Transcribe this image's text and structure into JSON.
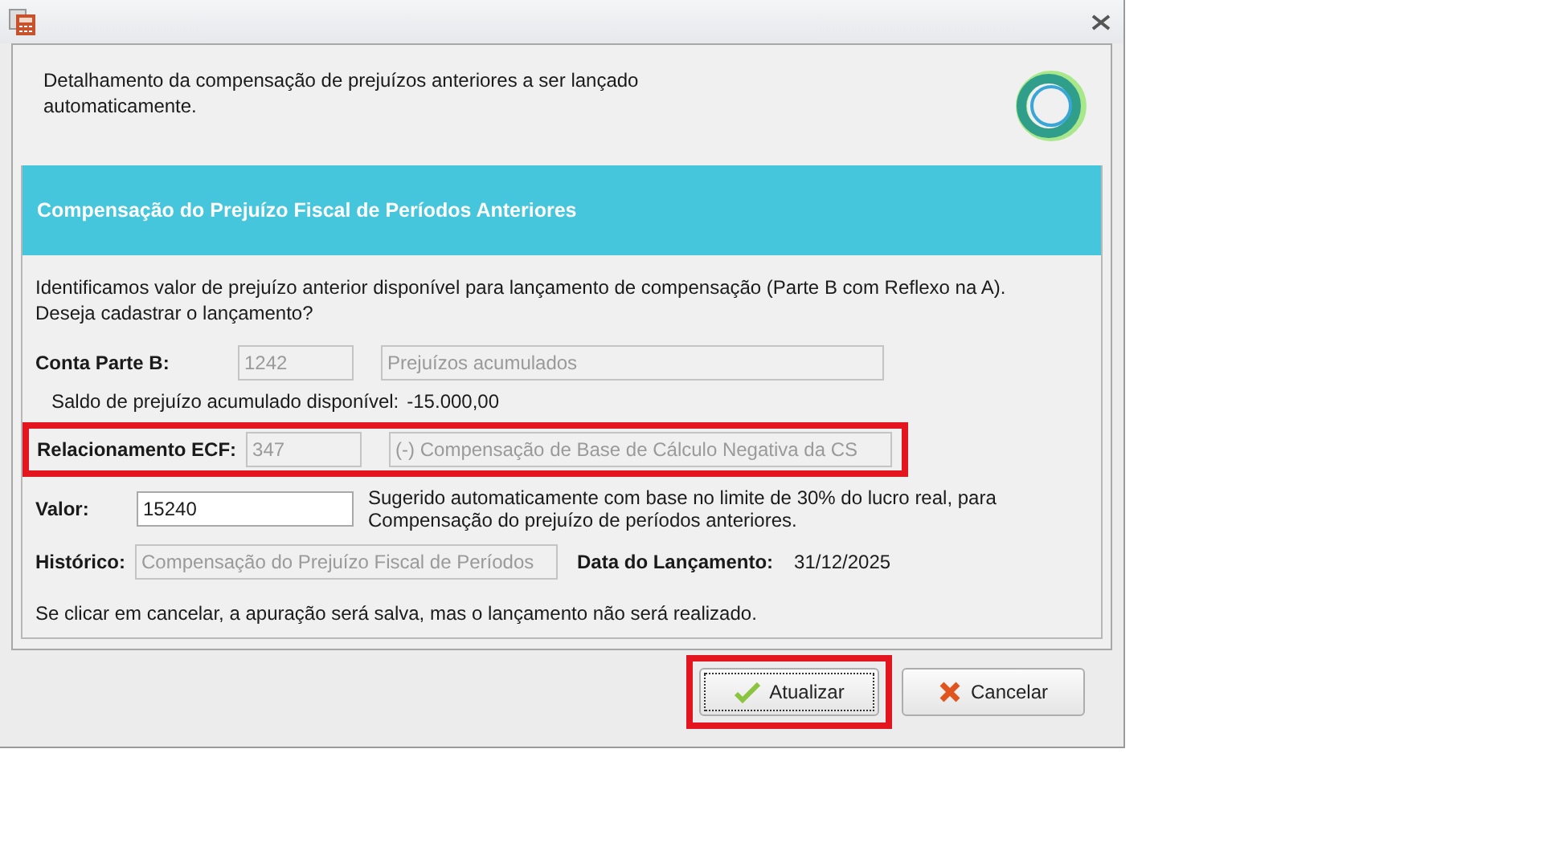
{
  "header": {
    "lines": [
      "Detalhamento da compensação de prejuízos anteriores a ser lançado",
      "automaticamente."
    ]
  },
  "section": {
    "title": "Compensação do Prejuízo Fiscal de Períodos Anteriores"
  },
  "intro": {
    "lines": [
      "Identificamos valor de prejuízo anterior disponível para lançamento de compensação (Parte B com Reflexo na A).",
      "Deseja cadastrar o lançamento?"
    ]
  },
  "conta_parte_b": {
    "label": "Conta Parte B:",
    "code": "1242",
    "name": "Prejuízos acumulados",
    "disabled": true
  },
  "saldo": {
    "label": "Saldo de prejuízo acumulado disponível:",
    "value": "-15.000,00"
  },
  "relacionamento": {
    "label": "Relacionamento ECF:",
    "code": "347",
    "name": "(-) Compensação de Base de Cálculo Negativa da CS",
    "disabled": true,
    "highlighted": true
  },
  "valor": {
    "label": "Valor:",
    "value": "15240",
    "disabled": false,
    "hint_lines": [
      "Sugerido automaticamente com base no limite de 30% do lucro real, para",
      "Compensação do prejuízo de períodos anteriores."
    ]
  },
  "historico": {
    "label": "Histórico:",
    "value": "Compensação do Prejuízo Fiscal de Períodos",
    "disabled": true
  },
  "data_lancamento": {
    "label": "Data do Lançamento:",
    "value": "31/12/2025"
  },
  "note": "Se clicar em cancelar, a apuração será salva, mas o lançamento não será realizado.",
  "buttons": [
    {
      "label": "Atualizar",
      "kind": "confirm",
      "focused": true,
      "highlighted": true
    },
    {
      "label": "Cancelar",
      "kind": "cancel",
      "focused": false,
      "highlighted": false
    }
  ]
}
